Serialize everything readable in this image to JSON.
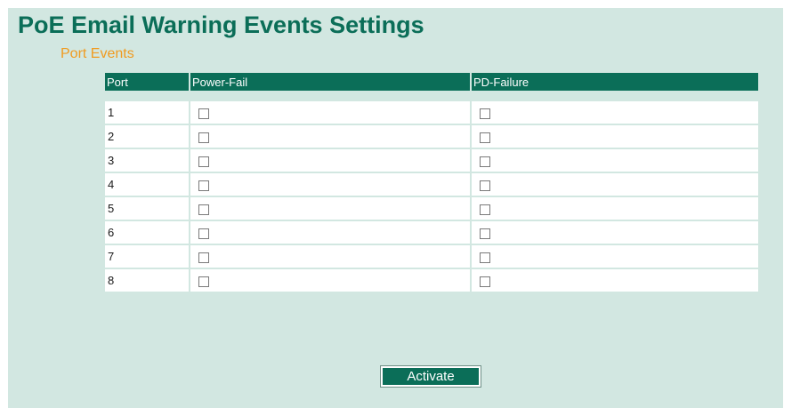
{
  "page": {
    "title": "PoE Email Warning Events Settings",
    "section_title": "Port Events"
  },
  "table": {
    "headers": [
      "Port",
      "Power-Fail",
      "PD-Failure"
    ],
    "rows": [
      {
        "port": "1",
        "power_fail": false,
        "pd_failure": false
      },
      {
        "port": "2",
        "power_fail": false,
        "pd_failure": false
      },
      {
        "port": "3",
        "power_fail": false,
        "pd_failure": false
      },
      {
        "port": "4",
        "power_fail": false,
        "pd_failure": false
      },
      {
        "port": "5",
        "power_fail": false,
        "pd_failure": false
      },
      {
        "port": "6",
        "power_fail": false,
        "pd_failure": false
      },
      {
        "port": "7",
        "power_fail": false,
        "pd_failure": false
      },
      {
        "port": "8",
        "power_fail": false,
        "pd_failure": false
      }
    ]
  },
  "actions": {
    "activate_label": "Activate"
  },
  "colors": {
    "background": "#d2e7e1",
    "accent": "#0b6e58",
    "section_title": "#f09b20"
  }
}
